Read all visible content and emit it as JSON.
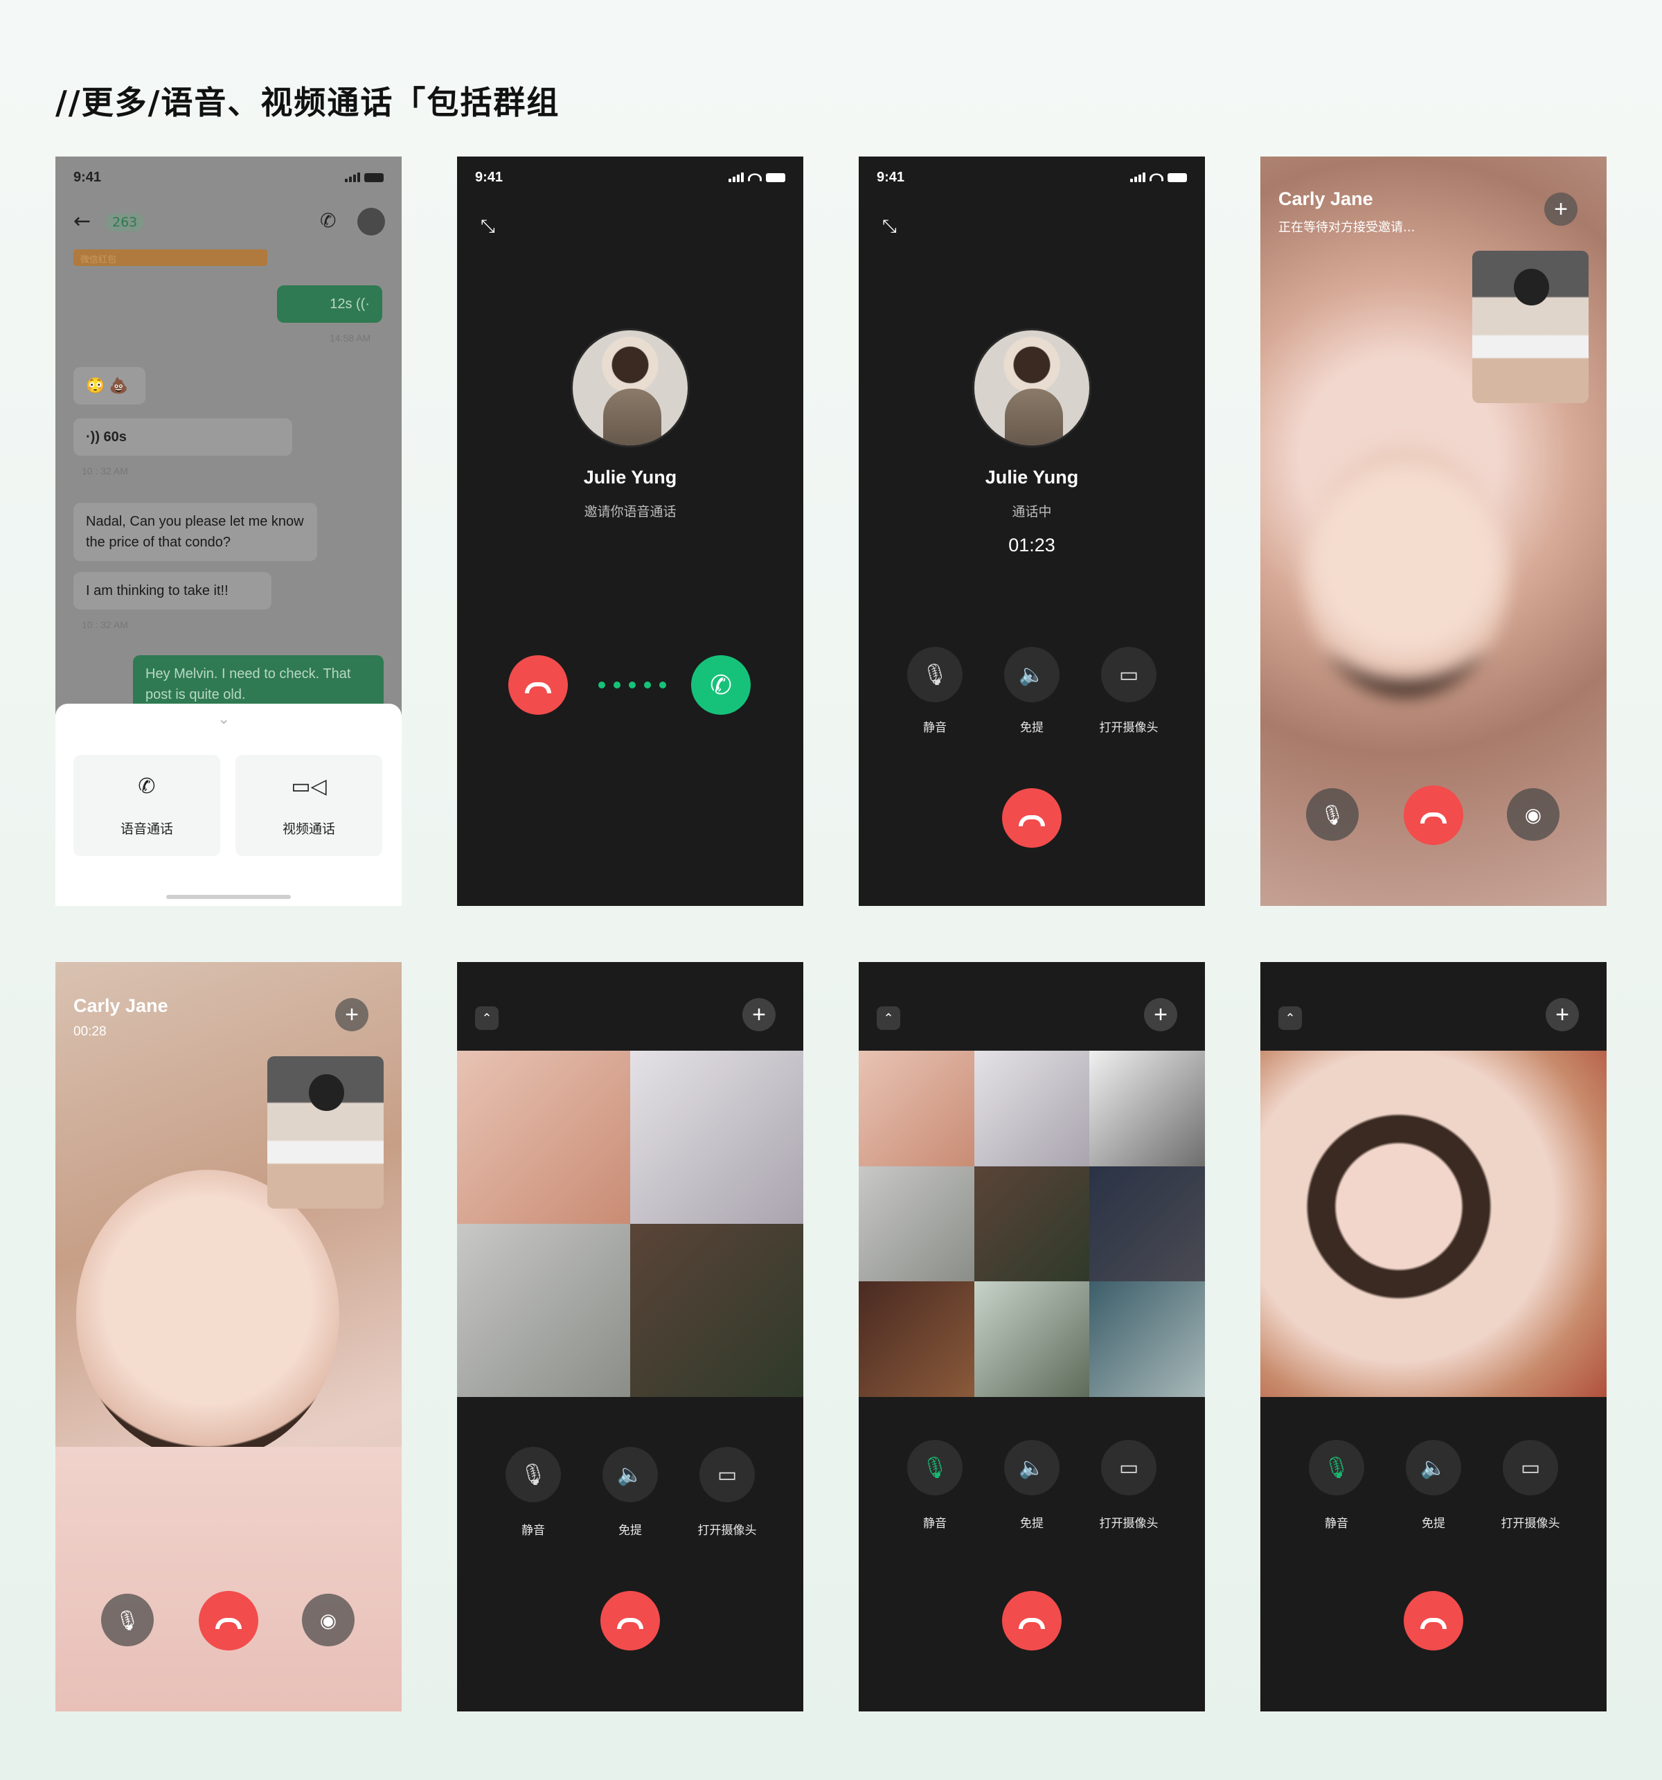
{
  "heading": "//更多/语音、视频通话「包括群组",
  "status_time": "9:41",
  "chat": {
    "badge_count": "263",
    "banner": "微信红包",
    "voice_out": "12s",
    "voice_out_time": "14:58 AM",
    "emojis": "😳 💩",
    "voice_in": "60s",
    "time1": "10 : 32 AM",
    "msg1": "Nadal, Can you please let me know the price of that condo?",
    "msg2": "I am thinking to take it!!",
    "time2": "10 : 32 AM",
    "msg3": "Hey Melvin. I need to check. That post is quite old."
  },
  "sheet": {
    "voice_call": "语音通话",
    "video_call": "视频通话"
  },
  "incoming": {
    "name": "Julie Yung",
    "subtitle": "邀请你语音通话"
  },
  "in_call": {
    "name": "Julie Yung",
    "subtitle": "通话中",
    "duration": "01:23"
  },
  "controls": {
    "mute": "静音",
    "speaker": "免提",
    "camera": "打开摄像头"
  },
  "video_waiting": {
    "name": "Carly Jane",
    "subtitle": "正在等待对方接受邀请..."
  },
  "video_active": {
    "name": "Carly Jane",
    "duration": "00:28"
  },
  "icons": {
    "mic": "mic-icon",
    "speaker": "speaker-icon",
    "camera": "video-camera-icon",
    "hangup": "hangup-icon",
    "accept": "phone-icon",
    "add": "plus-icon",
    "snap": "camera-icon"
  },
  "colors": {
    "hangup": "#f24c4c",
    "accept": "#16c27a",
    "muted_green": "#19b873",
    "call_bg": "#1b1b1b"
  }
}
